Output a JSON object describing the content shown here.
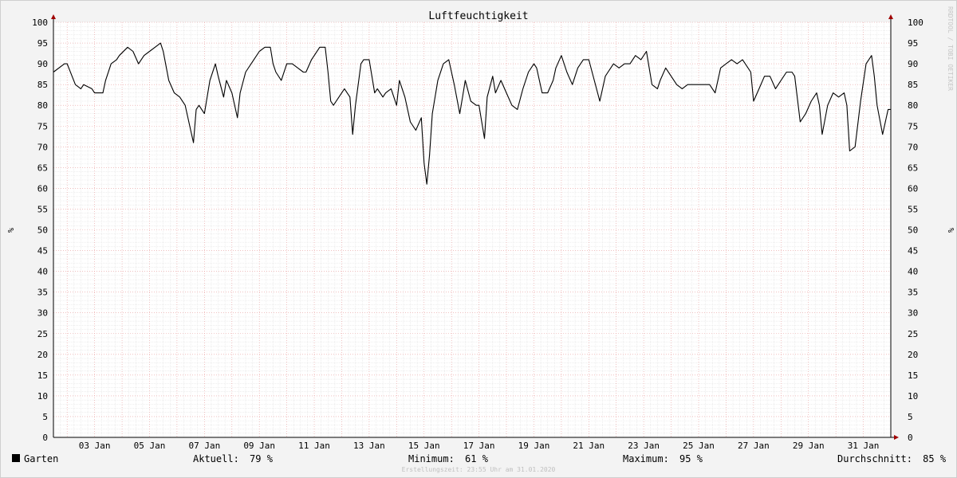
{
  "chart_data": {
    "type": "line",
    "title": "Luftfeuchtigkeit",
    "ylabel": "%",
    "ylim": [
      0,
      100
    ],
    "y_ticks": [
      0,
      5,
      10,
      15,
      20,
      25,
      30,
      35,
      40,
      45,
      50,
      55,
      60,
      65,
      70,
      75,
      80,
      85,
      90,
      95,
      100
    ],
    "x_tick_labels": [
      "03 Jan",
      "05 Jan",
      "07 Jan",
      "09 Jan",
      "11 Jan",
      "13 Jan",
      "15 Jan",
      "17 Jan",
      "19 Jan",
      "21 Jan",
      "23 Jan",
      "25 Jan",
      "27 Jan",
      "29 Jan",
      "31 Jan"
    ],
    "xlim_days": [
      1.5,
      32.0
    ],
    "x_tick_days": [
      3,
      5,
      7,
      9,
      11,
      13,
      15,
      17,
      19,
      21,
      23,
      25,
      27,
      29,
      31
    ],
    "series": [
      {
        "name": "Garten",
        "color": "#000000",
        "x_days": [
          1.5,
          1.9,
          2.0,
          2.3,
          2.5,
          2.6,
          2.9,
          3.0,
          3.3,
          3.4,
          3.6,
          3.8,
          3.9,
          4.2,
          4.4,
          4.6,
          4.8,
          5.0,
          5.2,
          5.4,
          5.5,
          5.7,
          5.9,
          6.1,
          6.3,
          6.5,
          6.6,
          6.7,
          6.8,
          7.0,
          7.2,
          7.4,
          7.5,
          7.7,
          7.8,
          8.0,
          8.2,
          8.3,
          8.5,
          8.8,
          9.0,
          9.2,
          9.4,
          9.5,
          9.6,
          9.8,
          10.0,
          10.2,
          10.4,
          10.6,
          10.7,
          10.9,
          11.2,
          11.4,
          11.5,
          11.6,
          11.7,
          11.9,
          12.1,
          12.3,
          12.4,
          12.5,
          12.7,
          12.8,
          13.0,
          13.2,
          13.3,
          13.5,
          13.6,
          13.8,
          14.0,
          14.1,
          14.3,
          14.5,
          14.7,
          14.9,
          15.0,
          15.1,
          15.2,
          15.3,
          15.5,
          15.7,
          15.9,
          16.1,
          16.3,
          16.4,
          16.5,
          16.7,
          16.9,
          17.0,
          17.2,
          17.3,
          17.5,
          17.6,
          17.8,
          18.0,
          18.2,
          18.4,
          18.6,
          18.8,
          19.0,
          19.1,
          19.3,
          19.5,
          19.7,
          19.8,
          20.0,
          20.2,
          20.4,
          20.6,
          20.8,
          21.0,
          21.2,
          21.4,
          21.6,
          21.7,
          21.9,
          22.1,
          22.3,
          22.5,
          22.7,
          22.9,
          23.1,
          23.3,
          23.5,
          23.6,
          23.8,
          24.0,
          24.2,
          24.4,
          24.6,
          24.8,
          25.0,
          25.2,
          25.4,
          25.6,
          25.8,
          26.0,
          26.2,
          26.4,
          26.6,
          26.7,
          26.9,
          27.0,
          27.2,
          27.4,
          27.6,
          27.8,
          28.0,
          28.2,
          28.4,
          28.5,
          28.7,
          28.9,
          29.1,
          29.3,
          29.4,
          29.5,
          29.7,
          29.9,
          30.1,
          30.3,
          30.4,
          30.5,
          30.7,
          30.9,
          31.1,
          31.3,
          31.4,
          31.5,
          31.7,
          31.9,
          32.0
        ],
        "values": [
          88,
          90,
          90,
          85,
          84,
          85,
          84,
          83,
          83,
          86,
          90,
          91,
          92,
          94,
          93,
          90,
          92,
          93,
          94,
          95,
          93,
          86,
          83,
          82,
          80,
          74,
          71,
          79,
          80,
          78,
          86,
          90,
          87,
          82,
          86,
          83,
          77,
          83,
          88,
          91,
          93,
          94,
          94,
          90,
          88,
          86,
          90,
          90,
          89,
          88,
          88,
          91,
          94,
          94,
          88,
          81,
          80,
          82,
          84,
          82,
          73,
          80,
          90,
          91,
          91,
          83,
          84,
          82,
          83,
          84,
          80,
          86,
          82,
          76,
          74,
          77,
          66,
          61,
          68,
          78,
          86,
          90,
          91,
          85,
          78,
          82,
          86,
          81,
          80,
          80,
          72,
          82,
          87,
          83,
          86,
          83,
          80,
          79,
          84,
          88,
          90,
          89,
          83,
          83,
          86,
          89,
          92,
          88,
          85,
          89,
          91,
          91,
          86,
          81,
          87,
          88,
          90,
          89,
          90,
          90,
          92,
          91,
          93,
          85,
          84,
          86,
          89,
          87,
          85,
          84,
          85,
          85,
          85,
          85,
          85,
          83,
          89,
          90,
          91,
          90,
          91,
          90,
          88,
          81,
          84,
          87,
          87,
          84,
          86,
          88,
          88,
          87,
          76,
          78,
          81,
          83,
          80,
          73,
          80,
          83,
          82,
          83,
          80,
          69,
          70,
          81,
          90,
          92,
          87,
          80,
          73,
          79,
          79,
          78
        ]
      }
    ],
    "legend": {
      "label": "Garten",
      "current_label": "Aktuell:",
      "current_value": "79 %",
      "min_label": "Minimum:",
      "min_value": "61 %",
      "max_label": "Maximum:",
      "max_value": "95 %",
      "avg_label": "Durchschnitt:",
      "avg_value": "85 %"
    },
    "side_note": "RRDTOOL / TOBI OETIKER",
    "footer": "Erstellungszeit: 23:55 Uhr am 31.01.2020",
    "colors": {
      "background": "#f3f3f3",
      "plot_bg": "#ffffff",
      "grid_minor": "#dedede",
      "grid_major": "#e89a9a",
      "axis_arrow": "#a00000",
      "line": "#000000"
    }
  }
}
